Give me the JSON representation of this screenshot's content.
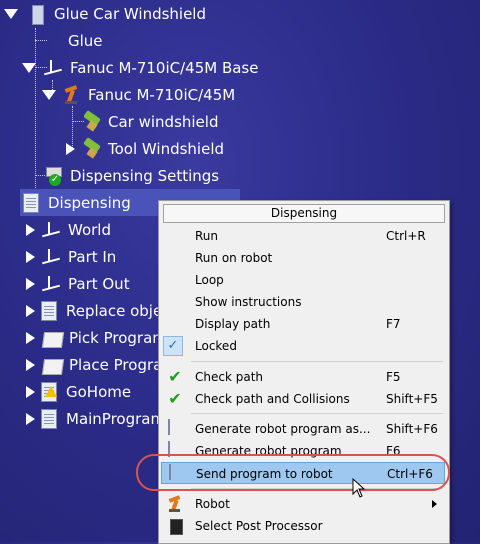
{
  "tree": {
    "root": "Glue Car Windshield",
    "glue": "Glue",
    "base": "Fanuc M-710iC/45M Base",
    "robot": "Fanuc M-710iC/45M",
    "car_windshield": "Car windshield",
    "tool_windshield": "Tool Windshield",
    "dispensing_settings": "Dispensing Settings",
    "dispensing": "Dispensing",
    "world": "World",
    "part_in": "Part In",
    "part_out": "Part Out",
    "replace": "Replace obje",
    "pick": "Pick Program",
    "place": "Place Progra",
    "gohome": "GoHome",
    "mainprogram": "MainProgram"
  },
  "menu": {
    "title": "Dispensing",
    "items": [
      {
        "label": "Run",
        "shortcut": "Ctrl+R"
      },
      {
        "label": "Run on robot",
        "shortcut": ""
      },
      {
        "label": "Loop",
        "shortcut": ""
      },
      {
        "label": "Show instructions",
        "shortcut": ""
      },
      {
        "label": "Display path",
        "shortcut": "F7"
      },
      {
        "label": "Locked",
        "shortcut": ""
      },
      {
        "label": "Check path",
        "shortcut": "F5"
      },
      {
        "label": "Check path and Collisions",
        "shortcut": "Shift+F5"
      },
      {
        "label": "Generate robot program as...",
        "shortcut": "Shift+F6"
      },
      {
        "label": "Generate robot program",
        "shortcut": "F6"
      },
      {
        "label": "Send program to robot",
        "shortcut": "Ctrl+F6"
      },
      {
        "label": "Robot",
        "shortcut": ""
      },
      {
        "label": "Select Post Processor",
        "shortcut": ""
      }
    ]
  },
  "colors": {
    "background": "#2c2c8a",
    "selection": "#4a53b8",
    "menu_highlight": "#9ec8f0",
    "annotation_ring": "#d9534f"
  }
}
